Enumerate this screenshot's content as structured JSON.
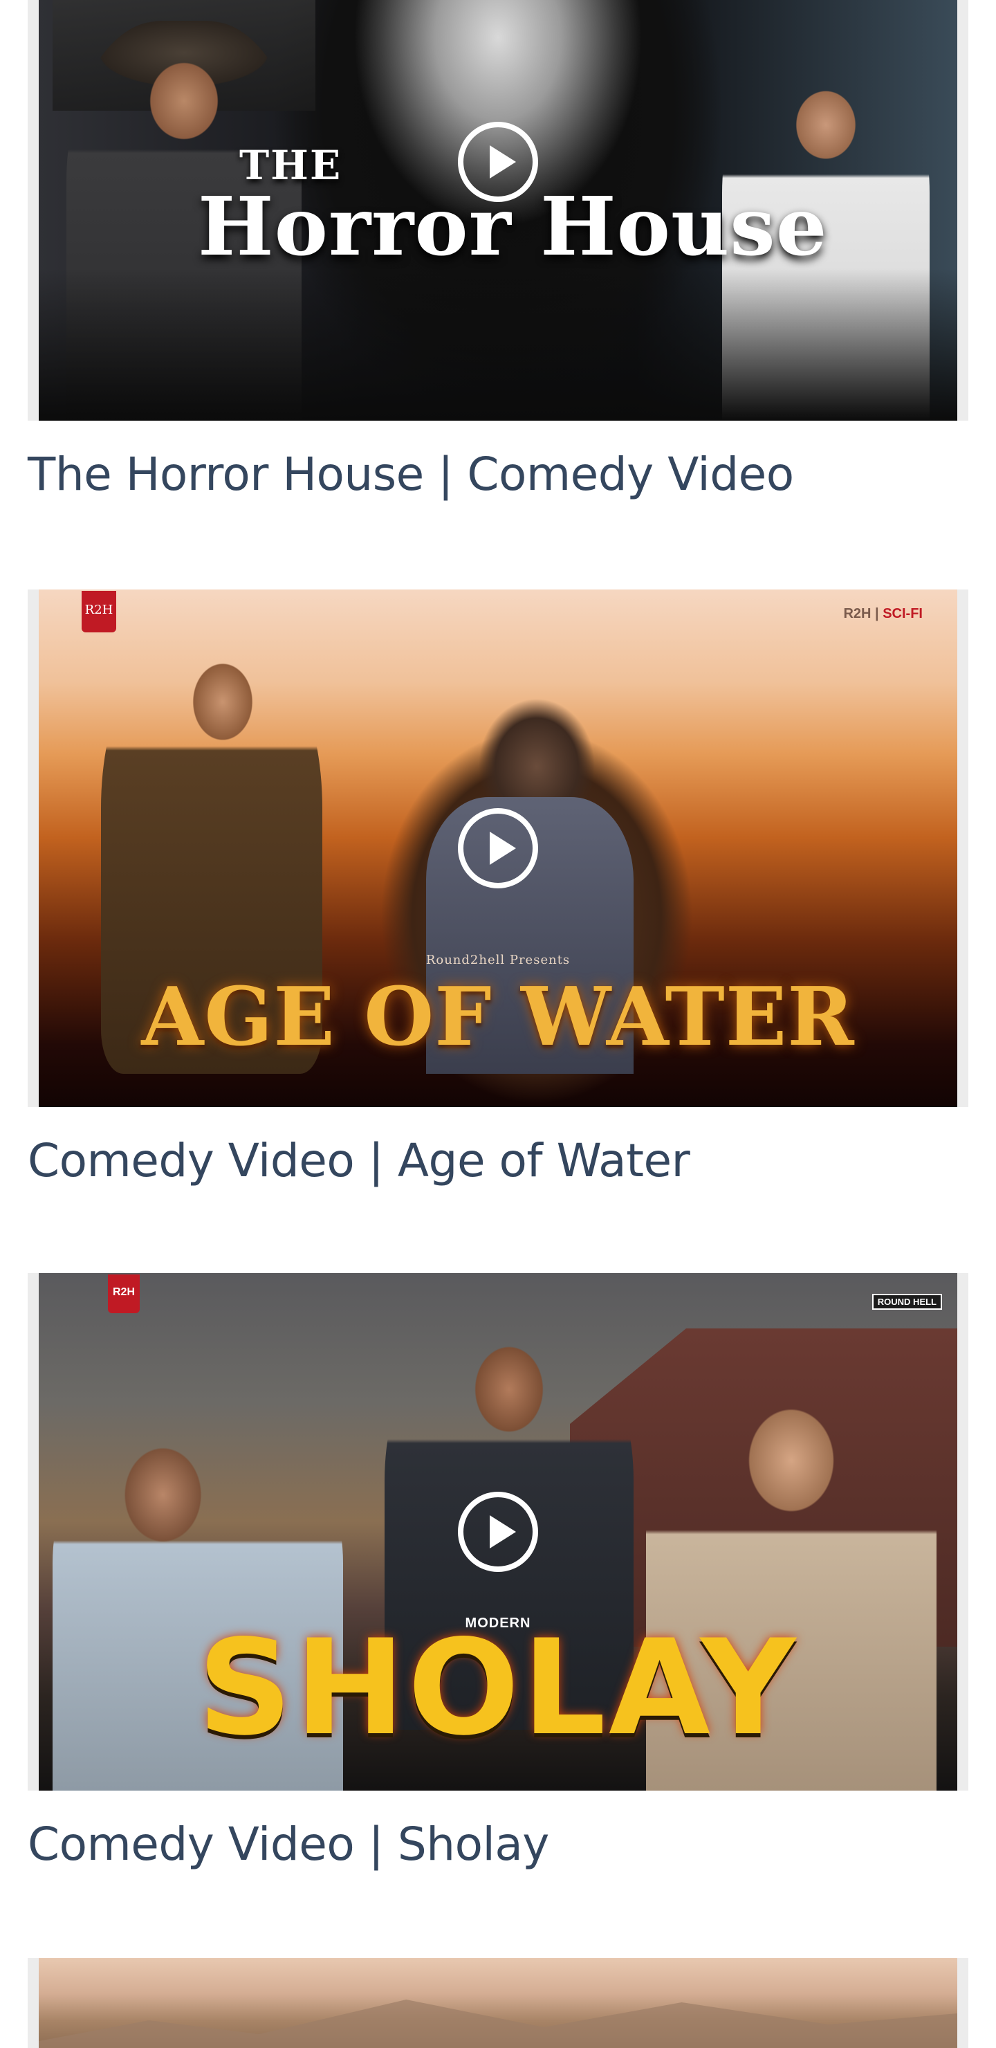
{
  "videos": [
    {
      "title": "The Horror House | Comedy Video",
      "thumbnail": {
        "line1": "THE",
        "line2": "Horror House"
      }
    },
    {
      "title": "Comedy Video | Age of Water",
      "thumbnail": {
        "badge": "R2H",
        "tag": "R2H",
        "tag_sep": " | ",
        "tag_accent": "SCI-FI",
        "presents": "Round2hell Presents",
        "headline": "AGE OF WATER"
      }
    },
    {
      "title": "Comedy Video | Sholay",
      "thumbnail": {
        "badge": "R2H",
        "tag": "ROUND HELL",
        "kicker": "MODERN",
        "headline": "SHOLAY"
      }
    },
    {
      "title": "",
      "thumbnail": {}
    }
  ],
  "colors": {
    "title_text": "#34465e",
    "play_icon": "#ffffff",
    "frame_bg": "#ececec"
  },
  "icons": {
    "play": "play-circle-icon"
  }
}
